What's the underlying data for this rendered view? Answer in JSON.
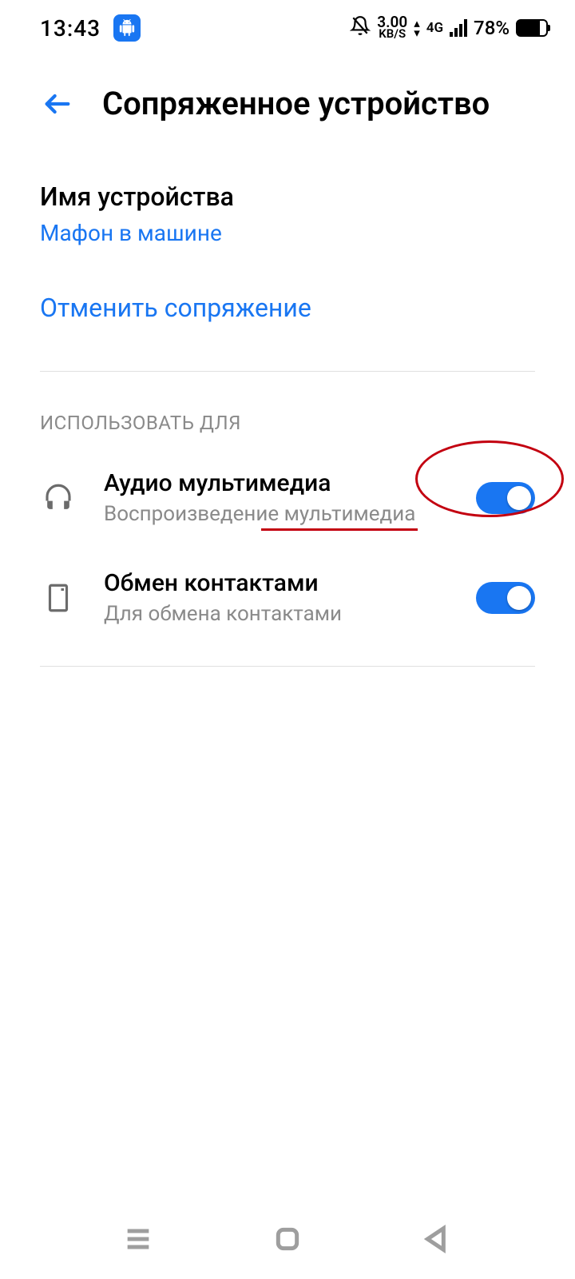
{
  "status_bar": {
    "time": "13:43",
    "net_speed_value": "3.00",
    "net_speed_unit": "KB/S",
    "net_type": "4G",
    "battery_pct": "78%"
  },
  "header": {
    "title": "Сопряженное устройство"
  },
  "device_name": {
    "label": "Имя устройства",
    "value": "Мафон в машине"
  },
  "unpair": {
    "label": "Отменить сопряжение"
  },
  "section": {
    "use_for": "ИСПОЛЬЗОВАТЬ ДЛЯ"
  },
  "profiles": [
    {
      "title": "Аудио мультимедиа",
      "subtitle": "Воспроизведение мультимедиа",
      "enabled": true
    },
    {
      "title": "Обмен контактами",
      "subtitle": "Для обмена контактами",
      "enabled": true
    }
  ],
  "colors": {
    "accent": "#1976f2",
    "annotation": "#c30010"
  }
}
